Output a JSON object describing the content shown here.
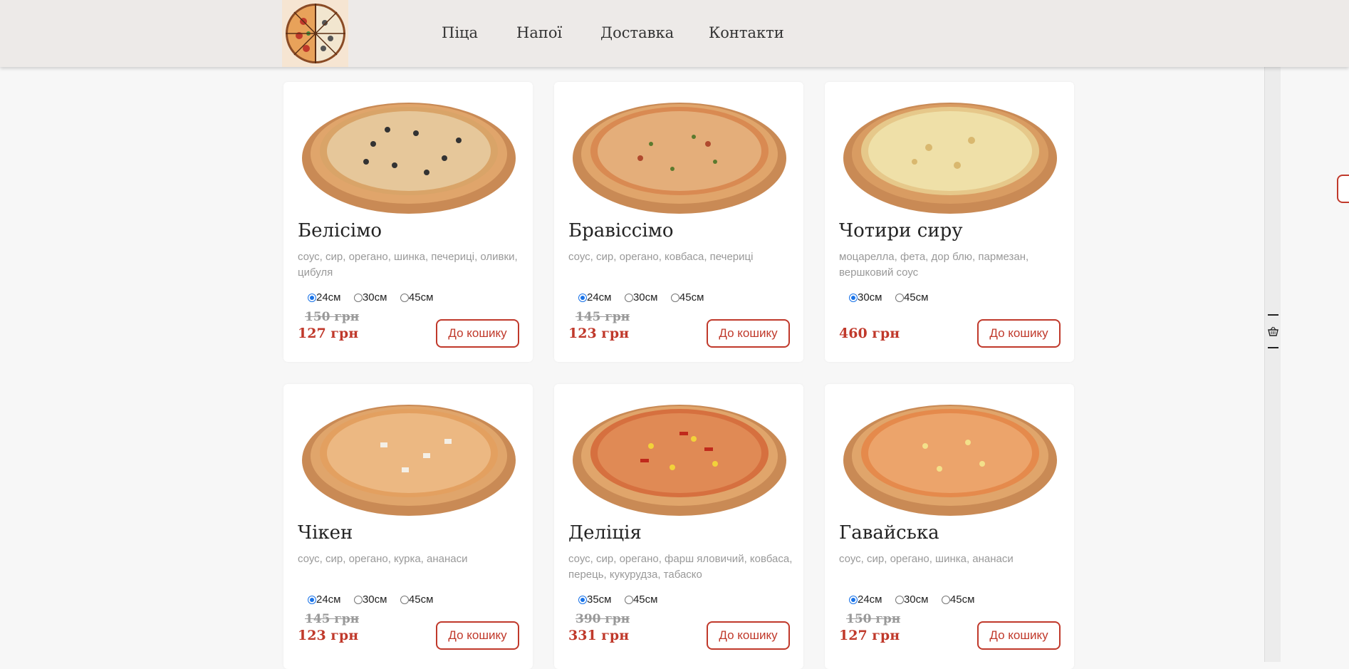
{
  "header": {
    "nav": [
      {
        "label": "Піца"
      },
      {
        "label": "Напої"
      },
      {
        "label": "Доставка"
      },
      {
        "label": "Контакти"
      }
    ]
  },
  "products": [
    {
      "name": "Белісімо",
      "desc": "соус, сир, орегано, шинка, печериці, оливки, цибуля",
      "sizes": [
        {
          "label": "24см",
          "checked": true
        },
        {
          "label": "30см",
          "checked": false
        },
        {
          "label": "45см",
          "checked": false
        }
      ],
      "old_price": "150 грн",
      "price": "127 грн",
      "button": "До кошику"
    },
    {
      "name": "Бравіссімо",
      "desc": "соус, сир, орегано, ковбаса, печериці",
      "sizes": [
        {
          "label": "24см",
          "checked": true
        },
        {
          "label": "30см",
          "checked": false
        },
        {
          "label": "45см",
          "checked": false
        }
      ],
      "old_price": "145 грн",
      "price": "123 грн",
      "button": "До кошику"
    },
    {
      "name": "Чотири сиру",
      "desc": "моцарелла, фета, дор блю, пармезан, вершковий соус",
      "sizes": [
        {
          "label": "30см",
          "checked": true
        },
        {
          "label": "45см",
          "checked": false
        }
      ],
      "old_price": "",
      "price": "460 грн",
      "button": "До кошику"
    },
    {
      "name": "Чікен",
      "desc": "соус, сир, орегано, курка, ананаси",
      "sizes": [
        {
          "label": "24см",
          "checked": true
        },
        {
          "label": "30см",
          "checked": false
        },
        {
          "label": "45см",
          "checked": false
        }
      ],
      "old_price": "145 грн",
      "price": "123 грн",
      "button": "До кошику"
    },
    {
      "name": "Деліція",
      "desc": "соус, сир, орегано, фарш яловичий, ковбаса, перець, кукурудза, табаско",
      "sizes": [
        {
          "label": "35см",
          "checked": true
        },
        {
          "label": "45см",
          "checked": false
        }
      ],
      "old_price": "390 грн",
      "price": "331 грн",
      "button": "До кошику"
    },
    {
      "name": "Гавайська",
      "desc": "соус, сир, орегано, шинка, ананаси",
      "sizes": [
        {
          "label": "24см",
          "checked": true
        },
        {
          "label": "30см",
          "checked": false
        },
        {
          "label": "45см",
          "checked": false
        }
      ],
      "old_price": "150 грн",
      "price": "127 грн",
      "button": "До кошику"
    }
  ],
  "colors": {
    "accent": "#c0392b",
    "header_bg": "#edeae8",
    "page_bg": "#f7f7f7",
    "radio": "#1a73e8"
  },
  "icons": {
    "sidebar": "basket-icon"
  }
}
